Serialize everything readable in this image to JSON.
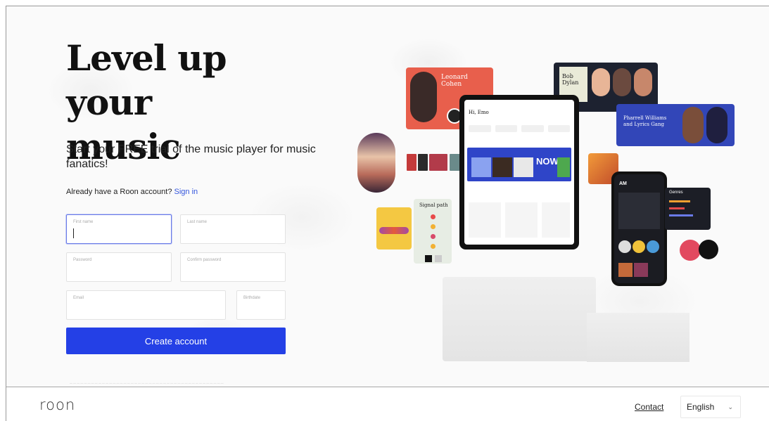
{
  "hero": {
    "headline_line1": "Level up your",
    "headline_line2": "music",
    "subtitle": "Start your FREE trial of the music player for music fanatics!",
    "account_prompt": "Already have a Roon account?",
    "signin_link": "Sign in"
  },
  "form": {
    "first_name_placeholder": "First name",
    "last_name_placeholder": "Last name",
    "password_placeholder": "Password",
    "confirm_password_placeholder": "Confirm password",
    "email_placeholder": "Email",
    "birthdate_placeholder": "Birthdate",
    "submit_label": "Create account"
  },
  "illustration": {
    "artist_card_1": "Leonard Cohen",
    "artist_card_2": "Bob Dylan",
    "tablet_greeting": "Hi, Emo",
    "now_text": "NOW",
    "signal_path_title": "Signal path",
    "featured_title": "Pharrell Williams and Lyrics Gang",
    "genres_title": "Genres",
    "phone_header": "AM"
  },
  "footer": {
    "logo": "roon",
    "contact_link": "Contact",
    "language": "English"
  },
  "colors": {
    "primary": "#2440e6",
    "link": "#3355dd"
  }
}
